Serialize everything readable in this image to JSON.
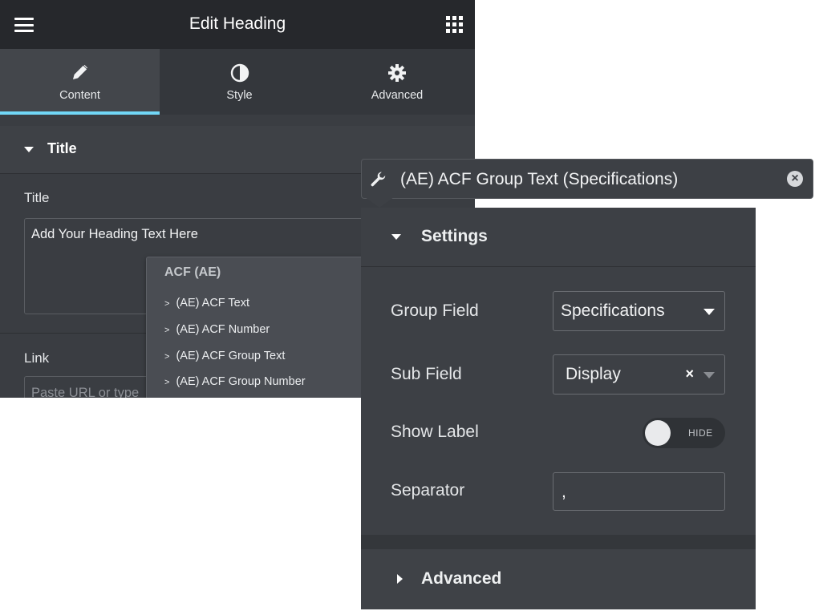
{
  "editor": {
    "title": "Edit Heading",
    "tabs": [
      {
        "label": "Content",
        "icon": "pencil-icon",
        "active": true
      },
      {
        "label": "Style",
        "icon": "contrast-icon",
        "active": false
      },
      {
        "label": "Advanced",
        "icon": "gear-icon",
        "active": false
      }
    ],
    "section_title": "Title",
    "title_field_label": "Title",
    "title_value": "Add Your Heading Text Here",
    "link_field_label": "Link",
    "link_placeholder": "Paste URL or type"
  },
  "dynamic_menu": {
    "group_label": "ACF (AE)",
    "options": [
      "(AE) ACF Text",
      "(AE) ACF Number",
      "(AE) ACF Group Text",
      "(AE) ACF Group Number"
    ]
  },
  "dynamic_tag": {
    "label": "(AE) ACF Group Text (Specifications)",
    "remove_symbol": "×"
  },
  "tag_settings": {
    "settings_label": "Settings",
    "group_field_label": "Group Field",
    "group_field_value": "Specifications",
    "sub_field_label": "Sub Field",
    "sub_field_value": "Display",
    "sub_field_clear": "×",
    "show_label_label": "Show Label",
    "show_label_state": "HIDE",
    "separator_label": "Separator",
    "separator_value": ",",
    "advanced_label": "Advanced"
  },
  "colors": {
    "panel_bg": "#3a3d42",
    "header_bg": "#26282c",
    "active_tab_indicator": "#71d7f7"
  }
}
